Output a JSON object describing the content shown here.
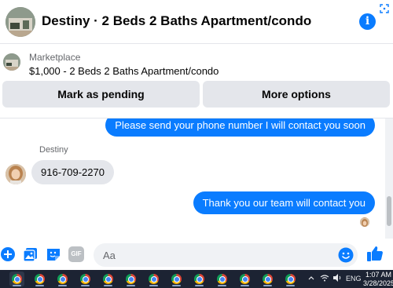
{
  "header": {
    "title": "Destiny · 2 Beds 2 Baths Apartment/condo",
    "info_icon": "info-icon",
    "corner_icon": "screenshot-icon"
  },
  "marketplace": {
    "label": "Marketplace",
    "listing": "$1,000 - 2 Beds 2 Baths Apartment/condo",
    "mark_pending_label": "Mark as pending",
    "more_options_label": "More options"
  },
  "thread": {
    "messages": [
      {
        "direction": "outgoing",
        "text": "Please send your phone number I will contact you soon"
      },
      {
        "direction": "incoming",
        "sender": "Destiny",
        "text": "916-709-2270"
      },
      {
        "direction": "outgoing",
        "text": "Thank you our team will contact you"
      }
    ]
  },
  "composer": {
    "placeholder": "Aa",
    "icons": [
      "plus-icon",
      "photo-icon",
      "sticker-icon",
      "gif-icon",
      "emoji-icon",
      "thumbs-up-icon"
    ],
    "gif_label": "GIF"
  },
  "taskbar": {
    "app_icon": "chrome-icon",
    "app_count": 13,
    "language": "ENG",
    "time": "1:07 AM",
    "date": "3/28/2025"
  },
  "colors": {
    "accent": "#0a7cff",
    "outgoing_bubble": "#0a7cff",
    "incoming_bubble": "#e4e6eb",
    "taskbar": "#1c2333"
  }
}
